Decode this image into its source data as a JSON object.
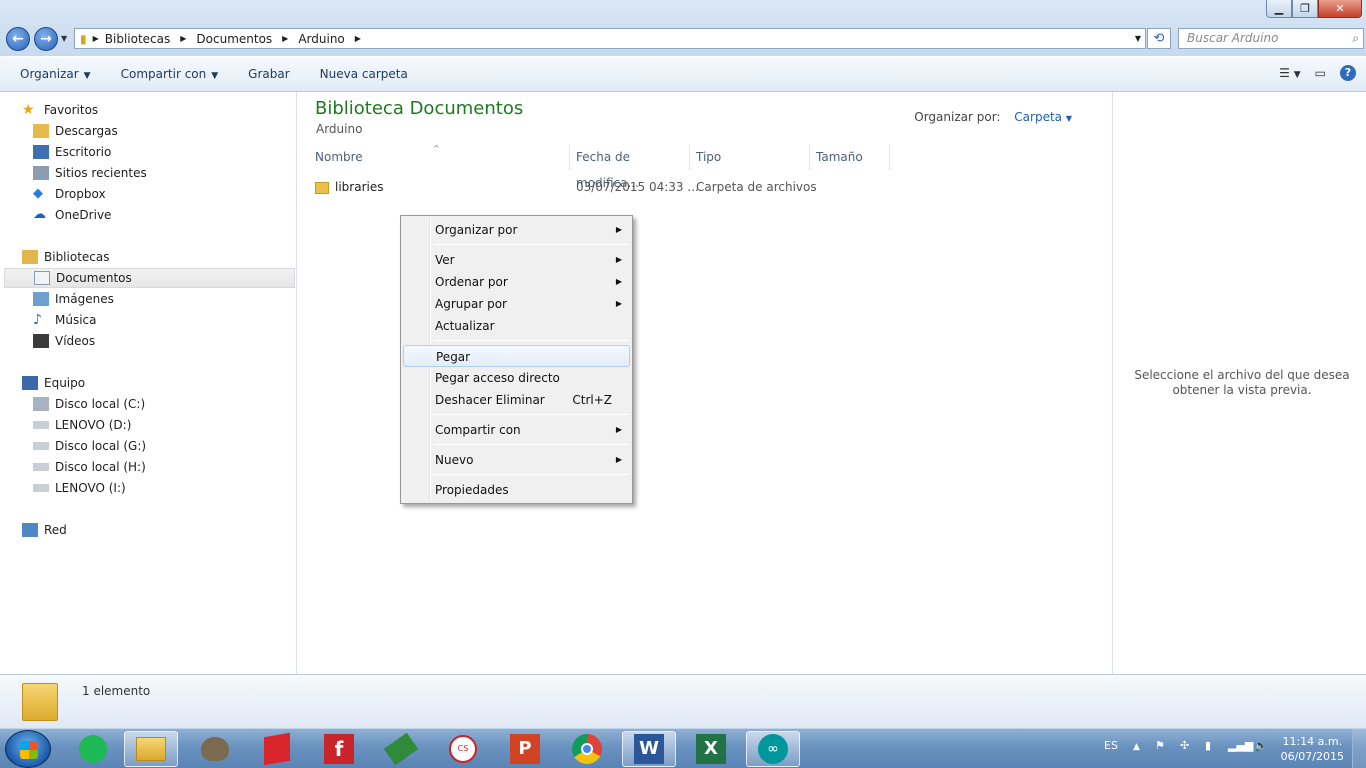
{
  "window": {
    "controls": {
      "minimize": "0",
      "maximize": "1",
      "close": "r"
    }
  },
  "address": {
    "crumbs": [
      "Bibliotecas",
      "Documentos",
      "Arduino"
    ],
    "search_placeholder": "Buscar Arduino"
  },
  "toolbar": {
    "organize": "Organizar",
    "share": "Compartir con",
    "burn": "Grabar",
    "new_folder": "Nueva carpeta"
  },
  "nav": {
    "favorites": "Favoritos",
    "fav_items": [
      "Descargas",
      "Escritorio",
      "Sitios recientes",
      "Dropbox",
      "OneDrive"
    ],
    "libraries": "Bibliotecas",
    "lib_items": [
      "Documentos",
      "Imágenes",
      "Música",
      "Vídeos"
    ],
    "computer": "Equipo",
    "drives": [
      "Disco local (C:)",
      "LENOVO (D:)",
      "Disco local (G:)",
      "Disco local (H:)",
      "LENOVO (I:)"
    ],
    "network": "Red"
  },
  "content": {
    "library_title": "Biblioteca Documentos",
    "library_subtitle": "Arduino",
    "arrange_label": "Organizar por:",
    "arrange_value": "Carpeta",
    "columns": [
      "Nombre",
      "Fecha de modifica...",
      "Tipo",
      "Tamaño"
    ],
    "files": [
      {
        "name": "libraries",
        "date": "03/07/2015 04:33 ...",
        "type": "Carpeta de archivos",
        "size": ""
      }
    ]
  },
  "preview": {
    "text": "Seleccione el archivo del que desea obtener la vista previa."
  },
  "status": {
    "count": "1 elemento"
  },
  "context_menu": {
    "organize_by": "Organizar por",
    "view": "Ver",
    "sort_by": "Ordenar por",
    "group_by": "Agrupar por",
    "refresh": "Actualizar",
    "paste": "Pegar",
    "paste_shortcut": "Pegar acceso directo",
    "undo_delete": "Deshacer Eliminar",
    "undo_shortcut": "Ctrl+Z",
    "share_with": "Compartir con",
    "new": "Nuevo",
    "properties": "Propiedades"
  },
  "taskbar": {
    "apps": [
      "Spotify",
      "Explorador de Windows",
      "GIMP",
      "SketchUp",
      "Fritzing",
      "PCB",
      "EAGLE",
      "PowerPoint",
      "Chrome",
      "Word",
      "Excel",
      "Arduino"
    ],
    "language": "ES",
    "time": "11:14 a.m.",
    "date": "06/07/2015"
  },
  "colors": {
    "library_title": "#1e7a1e",
    "accent": "#1e5fb3",
    "taskbar": "#6a92c0"
  }
}
